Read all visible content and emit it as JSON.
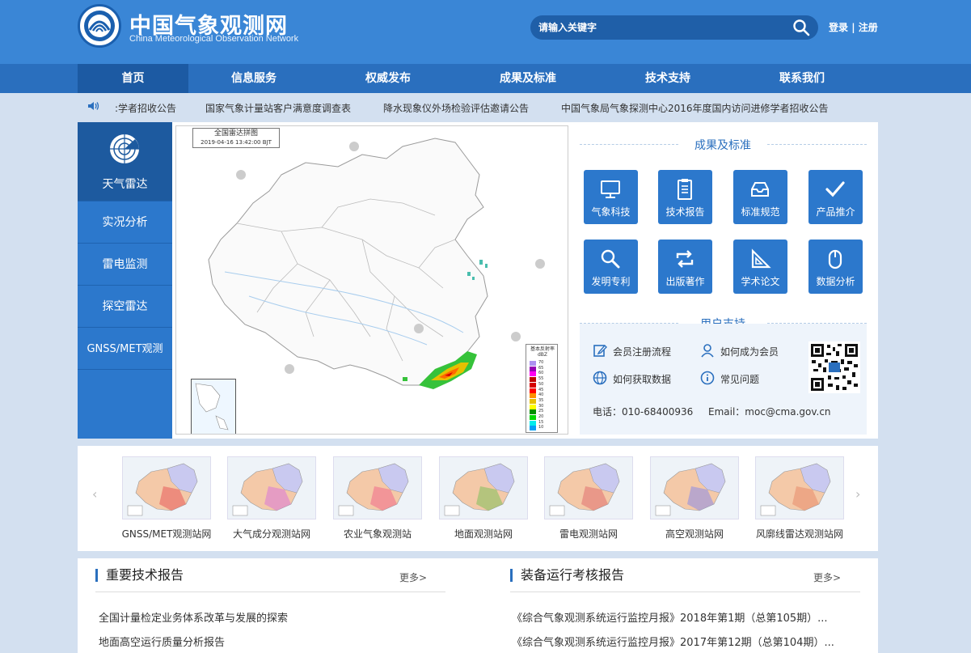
{
  "header": {
    "title": "中国气象观测网",
    "subtitle": "China Meteorological Observation Network",
    "search_placeholder": "请输入关键字",
    "login": "登录",
    "separator": "|",
    "register": "注册"
  },
  "nav": {
    "items": [
      {
        "label": "首页"
      },
      {
        "label": "信息服务"
      },
      {
        "label": "权威发布"
      },
      {
        "label": "成果及标准"
      },
      {
        "label": "技术支持"
      },
      {
        "label": "联系我们"
      }
    ]
  },
  "ticker": {
    "items": [
      ":学者招收公告",
      "国家气象计量站客户满意度调查表",
      "降水现象仪外场检验评估邀请公告",
      "中国气象局气象探测中心2016年度国内访问进修学者招收公告"
    ]
  },
  "radar_nav": {
    "items": [
      {
        "label": "天气雷达"
      },
      {
        "label": "实况分析"
      },
      {
        "label": "雷电监测"
      },
      {
        "label": "探空雷达"
      },
      {
        "label": "GNSS/MET观测"
      }
    ]
  },
  "map": {
    "title": "全国雷达拼图",
    "timestamp": "2019-04-16 13:42:00 BJT",
    "legend_title": "基本反射率",
    "legend_unit": "dBZ",
    "legend_values": [
      "70",
      "65",
      "60",
      "55",
      "50",
      "45",
      "40",
      "35",
      "30",
      "25",
      "20",
      "15",
      "10"
    ],
    "legend_colors": [
      "#ad90f0",
      "#9600b4",
      "#ff00f0",
      "#c00000",
      "#d60000",
      "#ff0000",
      "#ff9000",
      "#e7c000",
      "#ffff00",
      "#009000",
      "#00d800",
      "#00ecec",
      "#01a0f6"
    ]
  },
  "achievements": {
    "heading": "成果及标准",
    "tiles": [
      {
        "label": "气象科技",
        "icon": "monitor-icon"
      },
      {
        "label": "技术报告",
        "icon": "clipboard-icon"
      },
      {
        "label": "标准规范",
        "icon": "inbox-icon"
      },
      {
        "label": "产品推介",
        "icon": "check-icon"
      },
      {
        "label": "发明专利",
        "icon": "magnifier-icon"
      },
      {
        "label": "出版著作",
        "icon": "repeat-icon"
      },
      {
        "label": "学术论文",
        "icon": "set-square-icon"
      },
      {
        "label": "数据分析",
        "icon": "mouse-icon"
      }
    ]
  },
  "support": {
    "heading": "用户支持",
    "items": [
      {
        "label": "会员注册流程",
        "icon": "edit-icon"
      },
      {
        "label": "如何成为会员",
        "icon": "user-icon"
      },
      {
        "label": "如何获取数据",
        "icon": "globe-icon"
      },
      {
        "label": "常见问题",
        "icon": "info-icon"
      }
    ],
    "phone": "电话：010-68400936",
    "email": "Email：moc@cma.gov.cn"
  },
  "carousel": {
    "prev": "‹",
    "next": "›",
    "items": [
      {
        "label": "GNSS/MET观测站网"
      },
      {
        "label": "大气成分观测站网"
      },
      {
        "label": "农业气象观测站"
      },
      {
        "label": "地面观测站网"
      },
      {
        "label": "雷电观测站网"
      },
      {
        "label": "高空观测站网"
      },
      {
        "label": "风廓线雷达观测站网"
      }
    ]
  },
  "reports": {
    "left": {
      "heading": "重要技术报告",
      "more": "更多>",
      "items": [
        "全国计量检定业务体系改革与发展的探索",
        "地面高空运行质量分析报告"
      ]
    },
    "right": {
      "heading": "装备运行考核报告",
      "more": "更多>",
      "items": [
        "《综合气象观测系统运行监控月报》2018年第1期（总第105期）...",
        "《综合气象观测系统运行监控月报》2017年第12期（总第104期）..."
      ]
    }
  },
  "colors": {
    "header": "#3a86d6",
    "nav": "#2a6fbe",
    "tile": "#2c78cc",
    "page_bg": "#d3e0f0"
  }
}
